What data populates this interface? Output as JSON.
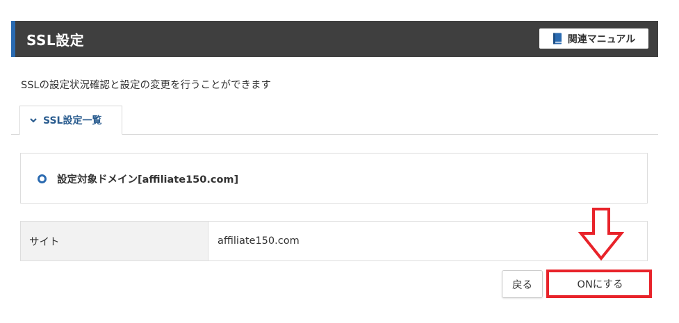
{
  "header": {
    "title": "SSL設定",
    "manual_button": "関連マニュアル",
    "accent_color": "#2a6ab0"
  },
  "description": "SSLの設定状況確認と設定の変更を行うことができます",
  "tabs": [
    {
      "label": "SSL設定一覧",
      "active": true
    }
  ],
  "domain_section": {
    "title": "設定対象ドメイン[affiliate150.com]"
  },
  "info_table": {
    "rows": [
      {
        "label": "サイト",
        "value": "affiliate150.com"
      }
    ]
  },
  "actions": {
    "back_label": "戻る",
    "on_label": "ONにする"
  },
  "annotation": {
    "highlight_color": "#e8232a"
  }
}
